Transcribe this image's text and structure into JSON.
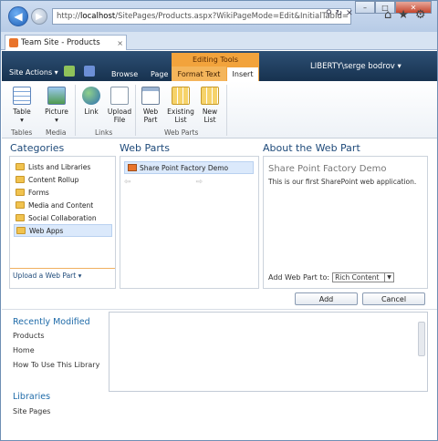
{
  "browser": {
    "url_prefix": "http://",
    "url_host": "localhost",
    "url_rest": "/SitePages/Products.aspx?WikiPageMode=Edit&InitialTabId=",
    "tab_title": "Team Site - Products",
    "tab_close": "×",
    "icons": [
      "back-icon",
      "forward-icon",
      "search-icon",
      "refresh-icon",
      "close-icon",
      "home-icon",
      "favorites-icon",
      "tools-icon"
    ],
    "window_controls": [
      "–",
      "□",
      "✕"
    ]
  },
  "ribbon": {
    "site_actions": "Site Actions ▾",
    "tabs": {
      "browse": "Browse",
      "page": "Page",
      "format_text": "Format Text",
      "insert": "Insert"
    },
    "context_group": "Editing Tools",
    "user": "LIBERTY\\serge bodrov ▾",
    "buttons": {
      "table": "Table",
      "picture": "Picture",
      "link": "Link",
      "upload_file": "Upload File",
      "web_part": "Web Part",
      "existing_list": "Existing List",
      "new_list": "New List"
    },
    "groups": {
      "tables": "Tables",
      "media": "Media",
      "links": "Links",
      "web_parts": "Web Parts"
    }
  },
  "categories": {
    "heading": "Categories",
    "items": [
      "Lists and Libraries",
      "Content Rollup",
      "Forms",
      "Media and Content",
      "Social Collaboration",
      "Web Apps"
    ],
    "selected": "Web Apps",
    "upload_label": "Upload a Web Part ▾"
  },
  "web_parts": {
    "heading": "Web Parts",
    "items": [
      "Share Point Factory Demo"
    ]
  },
  "about": {
    "heading": "About the Web Part",
    "title": "Share Point Factory Demo",
    "description": "This is our first SharePoint web application.",
    "add_to_label": "Add Web Part to:",
    "add_to_value": "Rich Content"
  },
  "actions": {
    "add": "Add",
    "cancel": "Cancel"
  },
  "left_nav": {
    "recently_modified": "Recently Modified",
    "recent_items": [
      "Products",
      "Home",
      "How To Use This Library"
    ],
    "libraries": "Libraries",
    "library_items": [
      "Site Pages"
    ]
  }
}
